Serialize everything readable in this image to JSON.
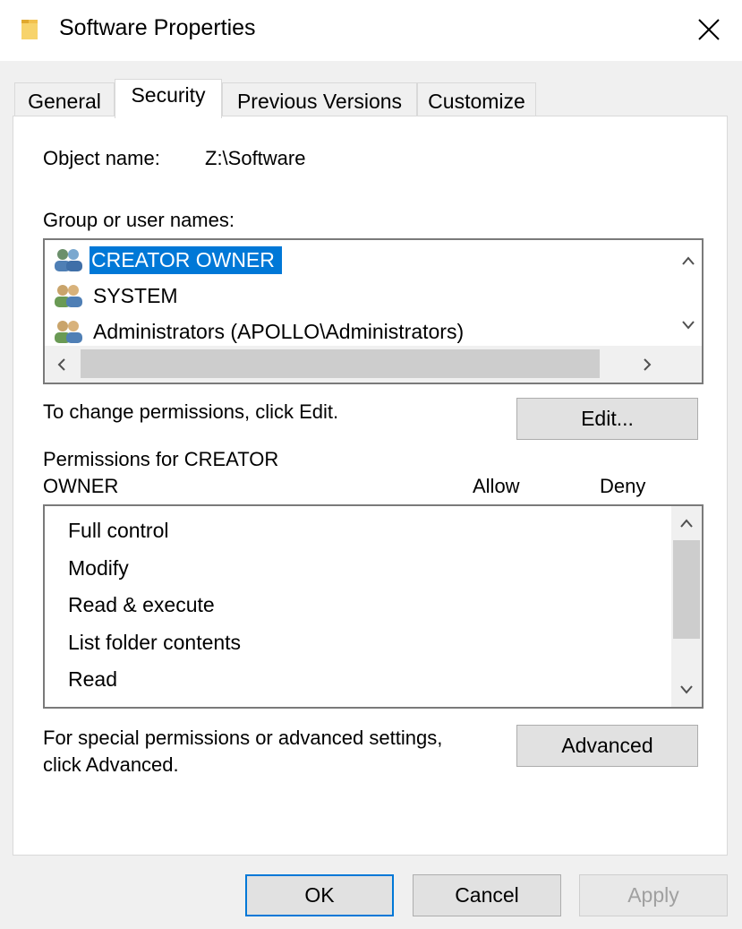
{
  "window": {
    "title": "Software Properties"
  },
  "tabs": [
    {
      "label": "General"
    },
    {
      "label": "Security"
    },
    {
      "label": "Previous Versions"
    },
    {
      "label": "Customize"
    }
  ],
  "security": {
    "object_name_label": "Object name:",
    "object_name_value": "Z:\\Software",
    "group_label": "Group or user names:",
    "users": [
      {
        "name": "CREATOR OWNER",
        "selected": true
      },
      {
        "name": "SYSTEM",
        "selected": false
      },
      {
        "name": "Administrators (APOLLO\\Administrators)",
        "selected": false
      }
    ],
    "change_hint": "To change permissions, click Edit.",
    "edit_button": "Edit...",
    "permissions_label_line1": "Permissions for CREATOR",
    "permissions_label_line2": "OWNER",
    "allow_header": "Allow",
    "deny_header": "Deny",
    "permissions": [
      {
        "name": "Full control"
      },
      {
        "name": "Modify"
      },
      {
        "name": "Read & execute"
      },
      {
        "name": "List folder contents"
      },
      {
        "name": "Read"
      }
    ],
    "advanced_hint_line1": "For special permissions or advanced settings,",
    "advanced_hint_line2": "click Advanced.",
    "advanced_button": "Advanced"
  },
  "footer": {
    "ok_label": "OK",
    "cancel_label": "Cancel",
    "apply_label": "Apply",
    "apply_enabled": false
  },
  "colors": {
    "selection": "#0078d7",
    "default_button_border": "#0078d7"
  },
  "icons": {
    "title": "folder-icon",
    "close": "close-icon",
    "user": "users-group-icon"
  }
}
